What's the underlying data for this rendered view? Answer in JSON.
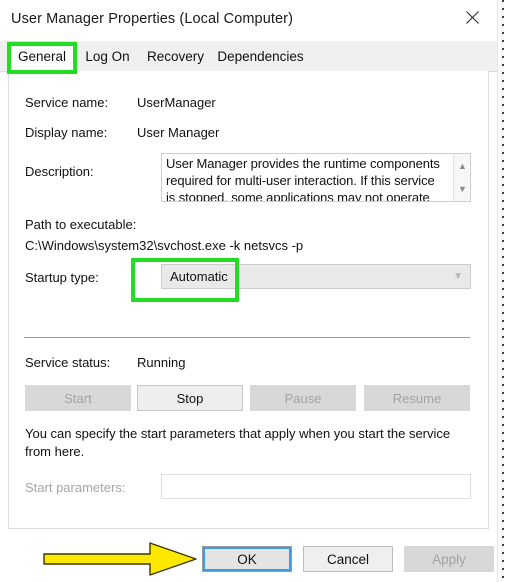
{
  "window": {
    "title": "User Manager Properties (Local Computer)",
    "close_icon": "close-x-icon"
  },
  "tabs": [
    {
      "label": "General",
      "active": true
    },
    {
      "label": "Log On",
      "active": false
    },
    {
      "label": "Recovery",
      "active": false
    },
    {
      "label": "Dependencies",
      "active": false
    }
  ],
  "general": {
    "service_name_label": "Service name:",
    "service_name_value": "UserManager",
    "display_name_label": "Display name:",
    "display_name_value": "User Manager",
    "description_label": "Description:",
    "description_value": "User Manager provides the runtime components required for multi-user interaction.  If this service is stopped, some applications may not operate correctly.",
    "description_scroll_up_icon": "chevron-up-icon",
    "description_scroll_down_icon": "chevron-down-icon",
    "path_label": "Path to executable:",
    "path_value": "C:\\Windows\\system32\\svchost.exe -k netsvcs -p",
    "startup_type_label": "Startup type:",
    "startup_type_value": "Automatic",
    "startup_type_arrow_icon": "chevron-down-icon",
    "service_status_label": "Service status:",
    "service_status_value": "Running",
    "controls": [
      {
        "label": "Start",
        "enabled": false
      },
      {
        "label": "Stop",
        "enabled": true
      },
      {
        "label": "Pause",
        "enabled": false
      },
      {
        "label": "Resume",
        "enabled": false
      }
    ],
    "hint_text": "You can specify the start parameters that apply when you start the service from here.",
    "start_parameters_label": "Start parameters:",
    "start_parameters_value": "",
    "start_parameters_enabled": false
  },
  "dialog_buttons": [
    {
      "label": "OK",
      "state": "default"
    },
    {
      "label": "Cancel",
      "state": "normal"
    },
    {
      "label": "Apply",
      "state": "disabled"
    }
  ],
  "annotations": {
    "highlight_color": "#22dd22",
    "arrow_color": "#ffe800",
    "arrow_outline_color": "#3a3a00",
    "general_tab_highlight": "green-rectangle-around-general-tab",
    "startup_type_highlight": "green-rectangle-around-automatic",
    "ok_button_pointer": "yellow-arrow-pointing-to-ok"
  }
}
